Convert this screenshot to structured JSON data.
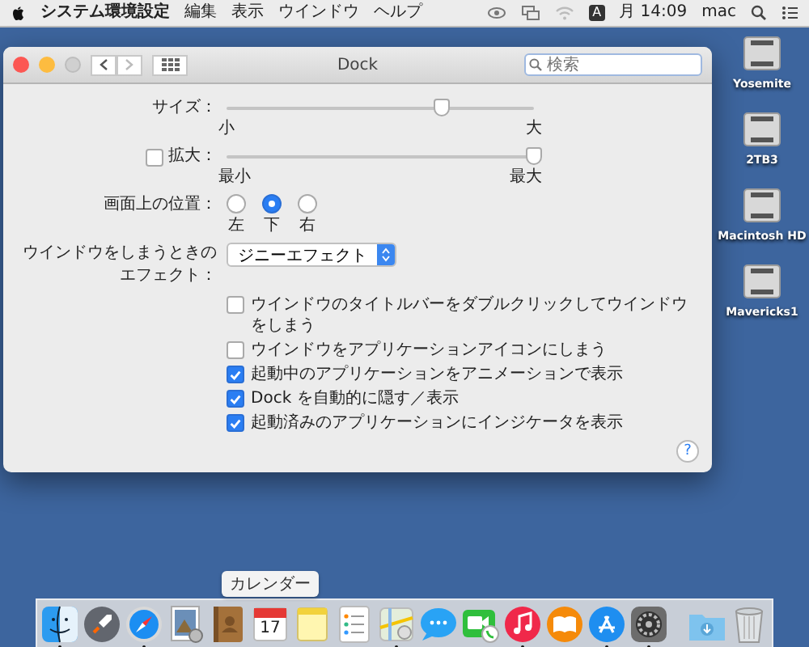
{
  "menu_bar": {
    "app_name": "システム環境設定",
    "menus": [
      "編集",
      "表示",
      "ウインドウ",
      "ヘルプ"
    ],
    "input_source": "A",
    "clock": "月 14:09",
    "user": "mac"
  },
  "window": {
    "title": "Dock",
    "traffic_lights": [
      {
        "kind": "close",
        "disabled": false
      },
      {
        "kind": "minimize",
        "disabled": false
      },
      {
        "kind": "zoom",
        "disabled": true
      }
    ],
    "search": {
      "placeholder": "検索"
    },
    "size": {
      "label": "サイズ：",
      "level": 0.7,
      "min_label": "小",
      "max_label": "大"
    },
    "magnification": {
      "label": "拡大：",
      "checked": false,
      "level": 1,
      "min_label": "最小",
      "max_label": "最大"
    },
    "position": {
      "label": "画面上の位置：",
      "options": [
        {
          "label": "左",
          "selected": false
        },
        {
          "label": "下",
          "selected": true
        },
        {
          "label": "右",
          "selected": false
        }
      ]
    },
    "minimize_effect": {
      "label": "ウインドウをしまうときのエフェクト：",
      "value": "ジニーエフェクト"
    },
    "options": [
      {
        "label": "ウインドウのタイトルバーをダブルクリックしてウインドウをしまう",
        "checked": false
      },
      {
        "label": "ウインドウをアプリケーションアイコンにしまう",
        "checked": false
      },
      {
        "label": "起動中のアプリケーションをアニメーションで表示",
        "checked": true
      },
      {
        "label": "Dock を自動的に隠す／表示",
        "checked": true
      },
      {
        "label": "起動済みのアプリケーションにインジケータを表示",
        "checked": true
      }
    ],
    "help": "?"
  },
  "desktop_icons": [
    {
      "name": "Yosemite"
    },
    {
      "name": "2TB3"
    },
    {
      "name": "Macintosh HD"
    },
    {
      "name": "Mavericks1"
    }
  ],
  "dock": {
    "tooltip": "カレンダー",
    "items": [
      {
        "kind": "finder",
        "running": true
      },
      {
        "kind": "launchpad",
        "running": false
      },
      {
        "kind": "safari",
        "running": true
      },
      {
        "kind": "preview",
        "running": false
      },
      {
        "kind": "contacts",
        "running": false
      },
      {
        "kind": "calendar",
        "running": false,
        "day": "17",
        "hovered": true
      },
      {
        "kind": "notes",
        "running": false
      },
      {
        "kind": "reminders",
        "running": false
      },
      {
        "kind": "maps",
        "running": true
      },
      {
        "kind": "messages",
        "running": false
      },
      {
        "kind": "facetime",
        "running": false
      },
      {
        "kind": "itunes",
        "running": true
      },
      {
        "kind": "ibooks",
        "running": false
      },
      {
        "kind": "appstore",
        "running": true
      },
      {
        "kind": "sysprefs",
        "running": true
      },
      {
        "kind": "separator"
      },
      {
        "kind": "downloads",
        "running": false
      },
      {
        "kind": "trash",
        "running": false
      }
    ]
  }
}
